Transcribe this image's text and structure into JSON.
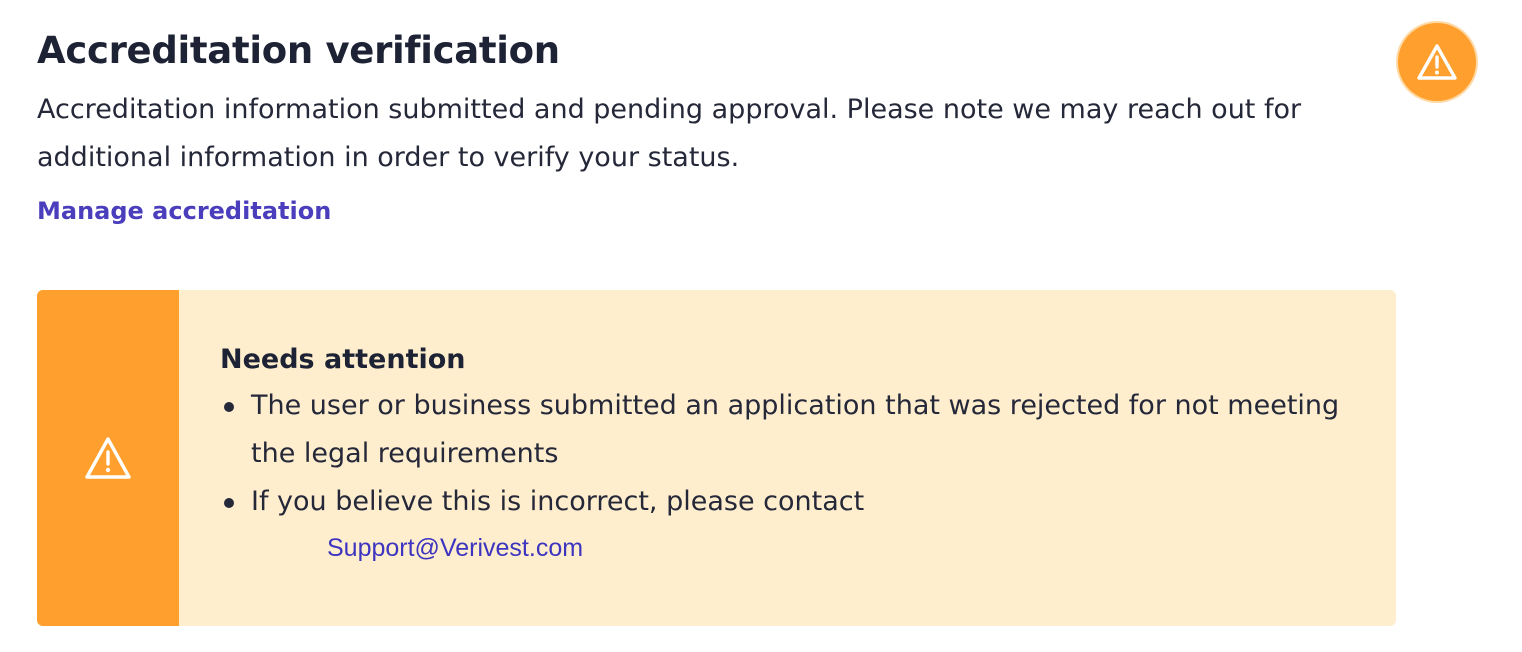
{
  "header": {
    "title": "Accreditation verification",
    "status_icon": "warning-icon",
    "status_color": "#ff9f2d"
  },
  "description": "Accreditation information submitted and pending approval. Please note we may reach out for additional information in order to verify your status.",
  "manage_link": {
    "label": "Manage accreditation",
    "color": "#4b3ebd"
  },
  "alert": {
    "icon": "warning-icon",
    "accent_color": "#ff9f2d",
    "background_color": "#feeecd",
    "title": "Needs attention",
    "items": [
      "The user or business submitted an application that was rejected for not meeting the legal requirements",
      "If you believe this is incorrect, please contact"
    ],
    "support_email": "Support@Verivest.com"
  }
}
